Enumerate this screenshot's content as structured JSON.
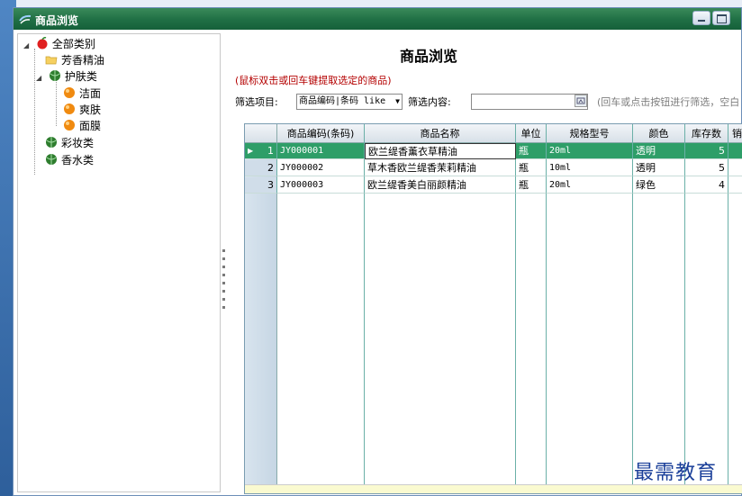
{
  "window": {
    "title": "商品浏览"
  },
  "tree": {
    "root": "全部类别",
    "nodes": [
      {
        "label": "芳香精油"
      },
      {
        "label": "护肤类"
      },
      {
        "label": "洁面"
      },
      {
        "label": "爽肤"
      },
      {
        "label": "面膜"
      },
      {
        "label": "彩妆类"
      },
      {
        "label": "香水类"
      }
    ]
  },
  "main": {
    "heading": "商品浏览",
    "hint": "(鼠标双击或回车键提取选定的商品)",
    "filter": {
      "item_label": "筛选项目:",
      "item_value": "商品编码|条码 like",
      "content_label": "筛选内容:",
      "content_value": "",
      "note": "(回车或点击按钮进行筛选，空白"
    }
  },
  "grid": {
    "columns": [
      "商品编码(条码)",
      "商品名称",
      "单位",
      "规格型号",
      "颜色",
      "库存数",
      "销"
    ],
    "rows": [
      {
        "no": "1",
        "code": "JY000001",
        "name": "欧兰缇香薰衣草精油",
        "unit": "瓶",
        "spec": "20ml",
        "color": "透明",
        "stock": "5"
      },
      {
        "no": "2",
        "code": "JY000002",
        "name": "草木香欧兰缇香茉莉精油",
        "unit": "瓶",
        "spec": "10ml",
        "color": "透明",
        "stock": "5"
      },
      {
        "no": "3",
        "code": "JY000003",
        "name": "欧兰缇香美白丽颜精油",
        "unit": "瓶",
        "spec": "20ml",
        "color": "绿色",
        "stock": "4"
      }
    ],
    "selected_row": 1
  },
  "watermark": "最需教育",
  "colors": {
    "title_bar": "#1f6f44",
    "selected_row": "#2e9e68",
    "hint": "#b40000"
  }
}
